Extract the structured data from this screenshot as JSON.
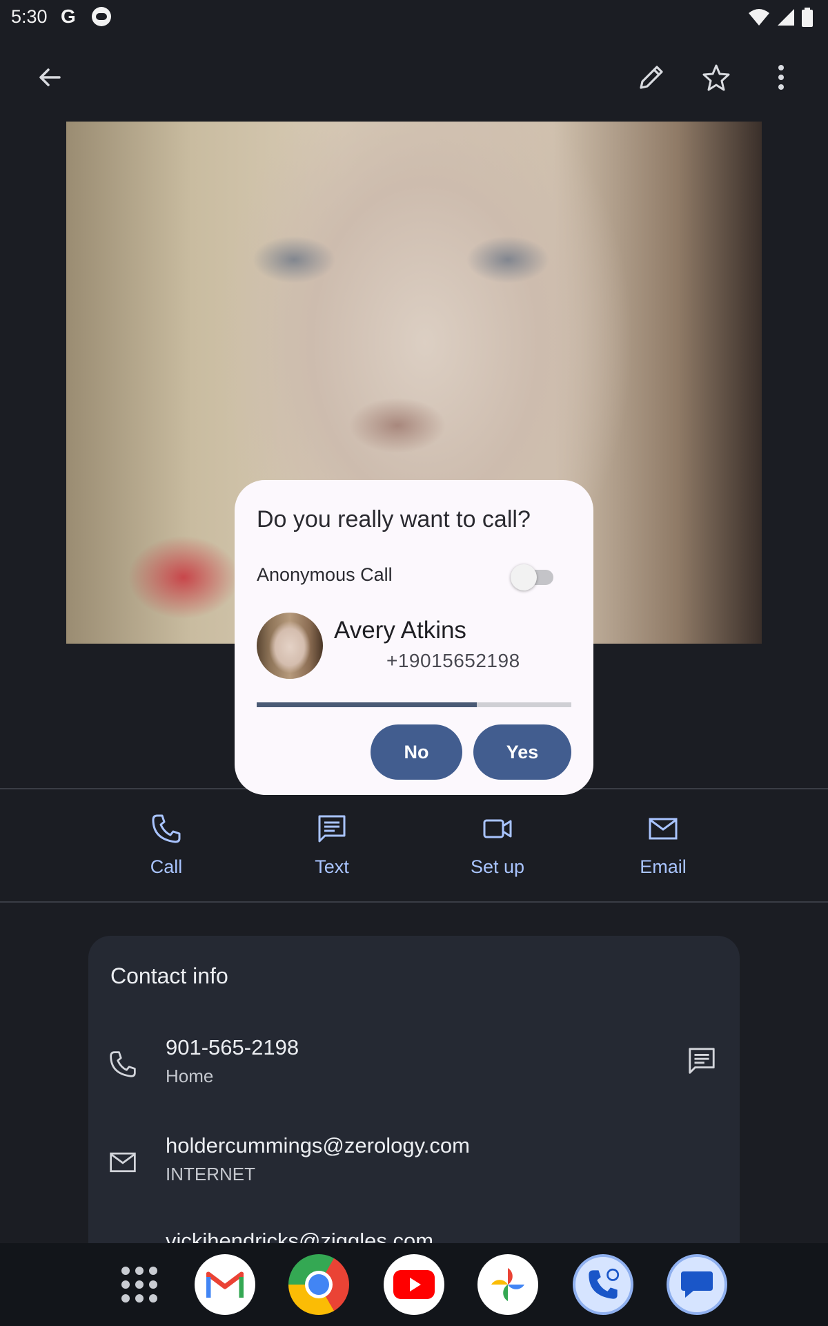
{
  "status_bar": {
    "time": "5:30",
    "google_glyph": "G",
    "icons": [
      "google-icon",
      "bug-icon",
      "wifi-icon",
      "signal-icon",
      "battery-icon"
    ]
  },
  "app_bar": {
    "icons": [
      "back-arrow-icon",
      "edit-pencil-icon",
      "star-outline-icon",
      "more-vert-icon"
    ]
  },
  "actions": [
    {
      "label": "Call",
      "icon": "phone-icon"
    },
    {
      "label": "Text",
      "icon": "message-icon"
    },
    {
      "label": "Set up",
      "icon": "videocam-icon"
    },
    {
      "label": "Email",
      "icon": "mail-icon"
    }
  ],
  "contact_info": {
    "title": "Contact info",
    "rows": [
      {
        "primary": "901-565-2198",
        "secondary": "Home",
        "icon": "phone-icon",
        "end_icon": "message-icon"
      },
      {
        "primary": "holdercummings@zerology.com",
        "secondary": "INTERNET",
        "icon": "mail-icon"
      },
      {
        "primary": "vickihendricks@ziggles.com",
        "secondary": "",
        "icon": "mail-icon"
      }
    ]
  },
  "dialog": {
    "title": "Do you really want to call?",
    "anonymous_label": "Anonymous Call",
    "anonymous_enabled": false,
    "contact_name": "Avery Atkins",
    "contact_number": "+19015652198",
    "progress": 0.7,
    "no_label": "No",
    "yes_label": "Yes"
  },
  "dock": {
    "apps": [
      "apps-grid-icon",
      "gmail-icon",
      "chrome-icon",
      "youtube-icon",
      "photos-icon",
      "phone-app-icon",
      "messages-icon"
    ]
  },
  "colors": {
    "background": "#1b1d23",
    "accent": "#a9c4ff",
    "dialog_bg": "#fcf8fd",
    "button": "#425d8f"
  }
}
